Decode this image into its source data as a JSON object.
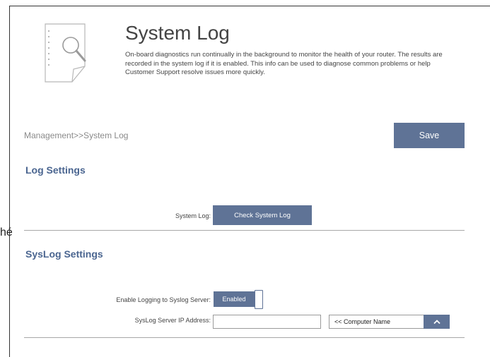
{
  "stray_text": "hé",
  "header": {
    "title": "System Log",
    "description": "On-board diagnostics run continually in the background to monitor the health of your router. The results are recorded in the system log if it is enabled. This info can be used to diagnose common problems or help Customer Support resolve issues more quickly."
  },
  "breadcrumb": "Management>>System Log",
  "toolbar": {
    "save_label": "Save"
  },
  "log_settings": {
    "title": "Log Settings",
    "system_log_label": "System Log:",
    "check_button_label": "Check System Log"
  },
  "syslog_settings": {
    "title": "SysLog Settings",
    "enable_label": "Enable Logging to Syslog Server:",
    "enable_state": "Enabled",
    "ip_label": "SysLog Server IP Address:",
    "ip_value": "",
    "computer_select_value": "<< Computer Name"
  },
  "colors": {
    "accent": "#5f7396",
    "section_title": "#4a6590"
  },
  "icons": [
    "magnifier-document-icon",
    "chevron-up-icon"
  ]
}
